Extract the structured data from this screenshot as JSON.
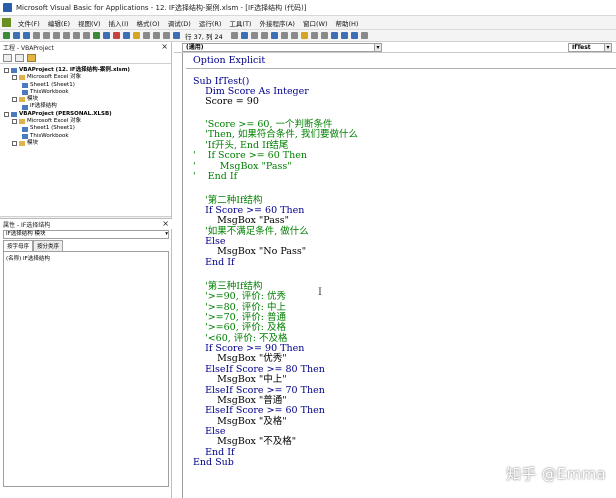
{
  "window": {
    "title": "Microsoft Visual Basic for Applications - 12. IF选择结构-案例.xlsm - [IF选择结构 (代码)]"
  },
  "menu": [
    "文件(F)",
    "编辑(E)",
    "视图(V)",
    "插入(I)",
    "格式(O)",
    "调试(D)",
    "运行(R)",
    "工具(T)",
    "外接程序(A)",
    "窗口(W)",
    "帮助(H)"
  ],
  "toolbar": {
    "cursor_pos": "行 37, 列 24"
  },
  "project_pane": {
    "title": "工程 - VBAProject",
    "tree": [
      {
        "text": "VBAProject (12. IF选择结构-案例.xlsm)",
        "level": 0,
        "bold": true
      },
      {
        "text": "Microsoft Excel 对象",
        "level": 1
      },
      {
        "text": "Sheet1 (Sheet1)",
        "level": 2
      },
      {
        "text": "ThisWorkbook",
        "level": 2
      },
      {
        "text": "模块",
        "level": 1
      },
      {
        "text": "IF选择结构",
        "level": 2
      },
      {
        "text": "VBAProject (PERSONAL.XLSB)",
        "level": 0,
        "bold": true
      },
      {
        "text": "Microsoft Excel 对象",
        "level": 1
      },
      {
        "text": "Sheet1 (Sheet1)",
        "level": 2
      },
      {
        "text": "ThisWorkbook",
        "level": 2
      },
      {
        "text": "模块",
        "level": 1
      }
    ]
  },
  "properties_pane": {
    "title": "属性 - IF选择结构",
    "combo": "IF选择结构 模块",
    "tab_alpha": "按字母序",
    "tab_category": "按分类序",
    "row": "(名称) IF选择结构"
  },
  "editor": {
    "object_combo": "(通用)",
    "proc_combo": "IfTest",
    "lines": [
      {
        "text": "Option Explicit",
        "type": "kw"
      },
      {
        "text": "Sub IfTest()",
        "type": "kw"
      },
      {
        "text": "    Dim Score As Integer",
        "type": "kw"
      },
      {
        "text": "    Score = 90",
        "type": "code"
      },
      {
        "text": "",
        "type": "code"
      },
      {
        "text": "    'Score >= 60, 一个判断条件",
        "type": "cm"
      },
      {
        "text": "    'Then, 如果符合条件, 我们要做什么",
        "type": "cm"
      },
      {
        "text": "    'If开头, End If结尾",
        "type": "cm"
      },
      {
        "text": "'    If Score >= 60 Then",
        "type": "cm"
      },
      {
        "text": "'        MsgBox \"Pass\"",
        "type": "cm"
      },
      {
        "text": "'    End If",
        "type": "cm"
      },
      {
        "text": "",
        "type": "code"
      },
      {
        "text": "    '第二种If结构",
        "type": "cm"
      },
      {
        "text": "    If Score >= 60 Then",
        "type": "kw"
      },
      {
        "text": "        MsgBox \"Pass\"",
        "type": "code"
      },
      {
        "text": "    '如果不满足条件, 做什么",
        "type": "cm"
      },
      {
        "text": "    Else",
        "type": "kw"
      },
      {
        "text": "        MsgBox \"No Pass\"",
        "type": "code"
      },
      {
        "text": "    End If",
        "type": "kw"
      },
      {
        "text": "",
        "type": "code"
      },
      {
        "text": "    '第三种If结构",
        "type": "cm"
      },
      {
        "text": "    '>=90, 评价: 优秀",
        "type": "cm"
      },
      {
        "text": "    '>=80, 评价: 中上",
        "type": "cm"
      },
      {
        "text": "    '>=70, 评价: 普通",
        "type": "cm"
      },
      {
        "text": "    '>=60, 评价: 及格",
        "type": "cm"
      },
      {
        "text": "    '<60, 评价: 不及格",
        "type": "cm"
      },
      {
        "text": "    If Score >= 90 Then",
        "type": "kw"
      },
      {
        "text": "        MsgBox \"优秀\"",
        "type": "code"
      },
      {
        "text": "    ElseIf Score >= 80 Then",
        "type": "kw"
      },
      {
        "text": "        MsgBox \"中上\"",
        "type": "code"
      },
      {
        "text": "    ElseIf Score >= 70 Then",
        "type": "kw"
      },
      {
        "text": "        MsgBox \"普通\"",
        "type": "code"
      },
      {
        "text": "    ElseIf Score >= 60 Then",
        "type": "kw"
      },
      {
        "text": "        MsgBox \"及格\"",
        "type": "code"
      },
      {
        "text": "    Else",
        "type": "kw"
      },
      {
        "text": "        MsgBox \"不及格\"",
        "type": "code"
      },
      {
        "text": "    End If",
        "type": "kw"
      },
      {
        "text": "End Sub",
        "type": "kw"
      }
    ]
  },
  "watermark": "知乎 @Emma"
}
